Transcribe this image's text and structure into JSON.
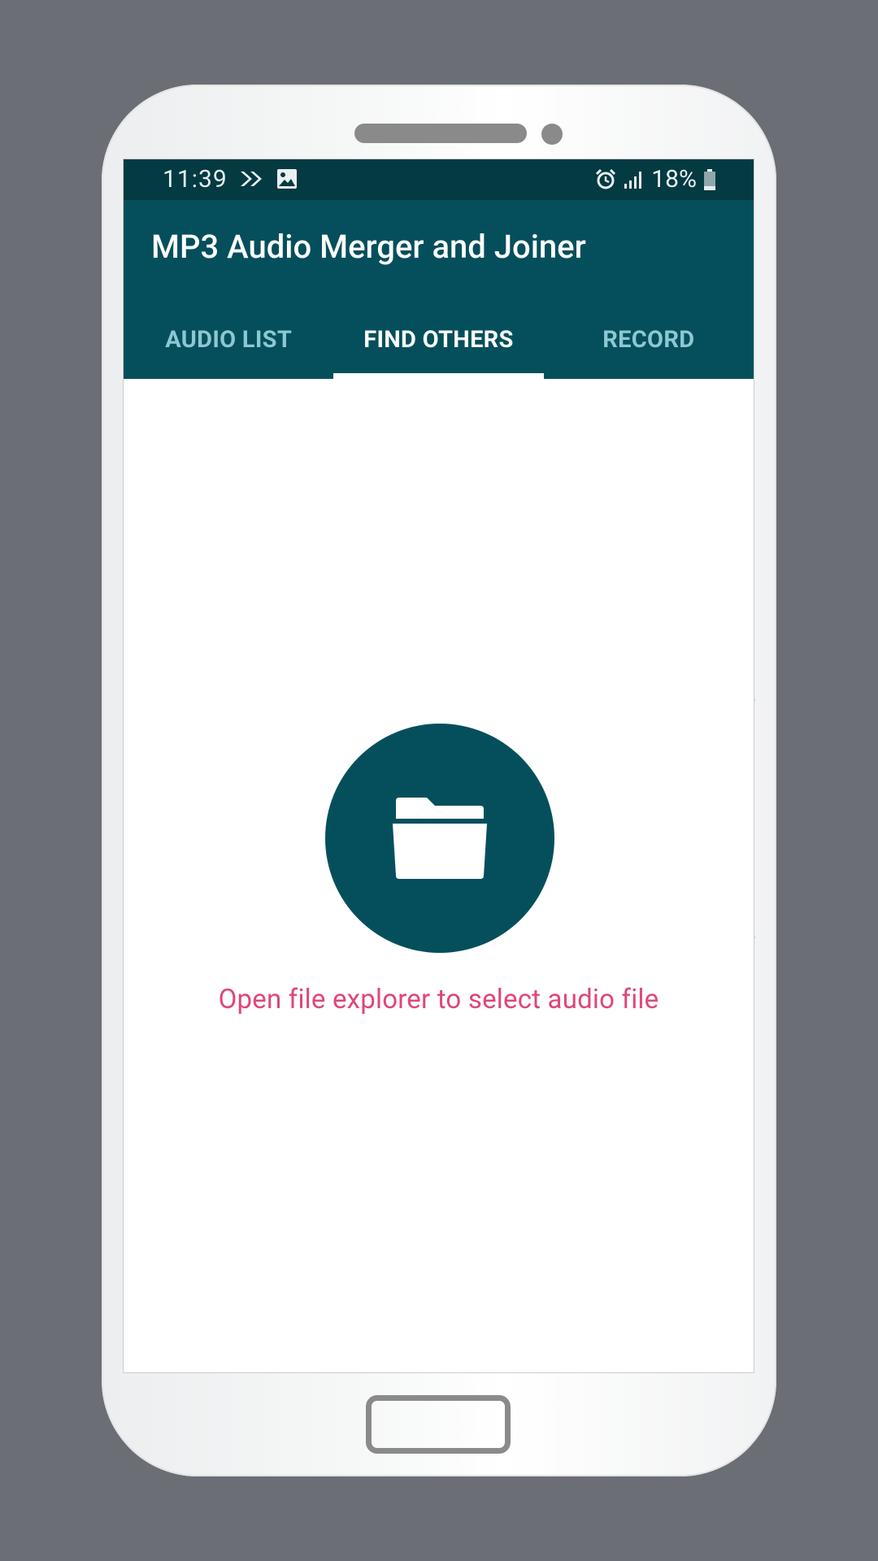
{
  "status_bar": {
    "time": "11:39",
    "battery": "18%",
    "left_icons": [
      "forward-arrows-icon",
      "image-icon"
    ],
    "right_icons": [
      "alarm-icon",
      "signal-icon",
      "battery-icon"
    ]
  },
  "app": {
    "title": "MP3 Audio Merger and Joiner"
  },
  "tabs": [
    {
      "label": "AUDIO LIST",
      "active": false
    },
    {
      "label": "FIND OTHERS",
      "active": true
    },
    {
      "label": "RECORD",
      "active": false
    }
  ],
  "main": {
    "folder_icon": "folder-open-icon",
    "hint": "Open file explorer to select audio file"
  },
  "colors": {
    "primary": "#054f5c",
    "status_bar": "#043a42",
    "accent_text": "#e0457c",
    "tab_inactive": "#8cc8d2"
  }
}
